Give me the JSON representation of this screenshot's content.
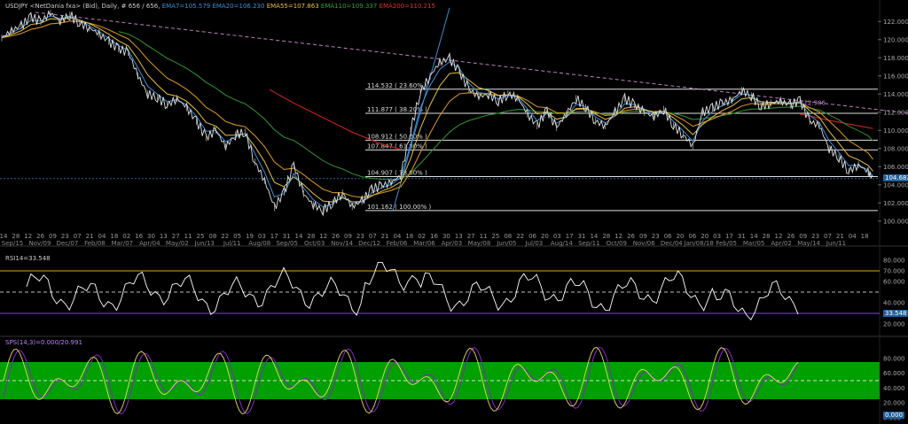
{
  "header": {
    "pair": "USDJPY",
    "source": "<NetDania fxa>",
    "feed": "(Bid), Daily",
    "bars": "# 656 / 656",
    "ema7": "EMA7=105.579",
    "ema20": "EMA20=106.230",
    "ema55": "EMA55=107.863",
    "ema110": "EMA110=109.337",
    "ema200": "EMA200=110.215"
  },
  "colors": {
    "background": "#000000",
    "price": "#e0e0e0",
    "ema7": "#3a8fd8",
    "ema20": "#e8c040",
    "ema55": "#d09020",
    "ema110": "#2e8a2e",
    "ema200": "#c02020",
    "rsi": "#ffffff",
    "rsi_low_line": "#8040ff",
    "rsi_high_line": "#e8a020",
    "stoch_k": "#e0e060",
    "stoch_d": "#9020d0",
    "stoch_band": "#00a000",
    "last_tag": "#2060a0",
    "trendline": "#c080c0"
  },
  "chart_data": [
    {
      "type": "line",
      "name": "price",
      "ylim": [
        99,
        123
      ],
      "y_ticks": [
        "122.000",
        "120.000",
        "118.000",
        "116.000",
        "114.000",
        "112.000",
        "110.000",
        "108.000",
        "106.000",
        "104.000",
        "102.000",
        "100.000"
      ],
      "x_tick_labels": [
        "14",
        "28",
        "12",
        "26",
        "09",
        "23",
        "07",
        "21",
        "04",
        "18",
        "02",
        "16",
        "30",
        "13",
        "27",
        "11",
        "25",
        "08",
        "22",
        "05",
        "19",
        "03",
        "17",
        "31",
        "14",
        "28",
        "12",
        "26",
        "09",
        "23",
        "07",
        "21",
        "04",
        "18",
        "02",
        "16",
        "30",
        "13",
        "27",
        "11",
        "25",
        "08",
        "22",
        "06",
        "20",
        "03",
        "17",
        "31",
        "14",
        "28",
        "12",
        "26",
        "09",
        "23",
        "06",
        "20",
        "06",
        "20",
        "03",
        "17",
        "31",
        "14",
        "28",
        "12",
        "26",
        "09",
        "23",
        "07",
        "21",
        "04",
        "18"
      ],
      "x_month_labels": [
        "Sep/15",
        "Nov/09",
        "Dec/07",
        "Feb/08",
        "Mar/07",
        "Apr/04",
        "May/02",
        "Jun/13",
        "Jul/11",
        "Aug/08",
        "Sep/05",
        "Oct/03",
        "Nov/14",
        "Dec/12",
        "Feb/06",
        "Mar/06",
        "Apr/03",
        "May/08",
        "Jun/05",
        "Jul/03",
        "Aug/14",
        "Sep/11",
        "Oct/09",
        "Nov/06",
        "Dec/04",
        "Jan/08/18",
        "Feb/05",
        "Mar/05",
        "Apr/02",
        "May/14",
        "Jun/11"
      ],
      "last_price": "104.682",
      "fib_levels": [
        {
          "label": "114.532 ( 23.60% )",
          "value": 114.532
        },
        {
          "label": "111.877 ( 38.20% )",
          "value": 111.877
        },
        {
          "label": "108.912 ( 50.00% )",
          "value": 108.912
        },
        {
          "label": "107.847 ( 61.80% )",
          "value": 107.847
        },
        {
          "label": "104.907 ( 78.60% )",
          "value": 104.907
        },
        {
          "label": "101.162 ( 100.00% )",
          "value": 101.162
        }
      ],
      "trendline_label": "112.986",
      "price_path": [
        [
          0,
          120.2
        ],
        [
          10,
          121.0
        ],
        [
          20,
          121.5
        ],
        [
          30,
          122.5
        ],
        [
          40,
          122.0
        ],
        [
          50,
          122.9
        ],
        [
          60,
          122.1
        ],
        [
          70,
          122.7
        ],
        [
          80,
          121.8
        ],
        [
          90,
          121.3
        ],
        [
          100,
          120.6
        ],
        [
          110,
          119.8
        ],
        [
          120,
          119.0
        ],
        [
          130,
          118.6
        ],
        [
          140,
          116.0
        ],
        [
          150,
          114.0
        ],
        [
          160,
          113.6
        ],
        [
          170,
          112.8
        ],
        [
          180,
          113.5
        ],
        [
          190,
          112.5
        ],
        [
          200,
          111.0
        ],
        [
          210,
          109.2
        ],
        [
          220,
          110.0
        ],
        [
          230,
          108.2
        ],
        [
          240,
          109.5
        ],
        [
          250,
          109.8
        ],
        [
          260,
          106.5
        ],
        [
          270,
          104.5
        ],
        [
          280,
          101.5
        ],
        [
          290,
          103.2
        ],
        [
          300,
          106.2
        ],
        [
          310,
          103.0
        ],
        [
          320,
          101.8
        ],
        [
          330,
          101.2
        ],
        [
          340,
          102.0
        ],
        [
          350,
          103.1
        ],
        [
          360,
          101.6
        ],
        [
          370,
          102.2
        ],
        [
          380,
          103.5
        ],
        [
          390,
          103.9
        ],
        [
          400,
          104.2
        ],
        [
          410,
          105.1
        ],
        [
          420,
          110.0
        ],
        [
          430,
          114.2
        ],
        [
          440,
          116.0
        ],
        [
          450,
          117.5
        ],
        [
          460,
          117.9
        ],
        [
          470,
          116.5
        ],
        [
          480,
          114.5
        ],
        [
          490,
          113.7
        ],
        [
          500,
          114.0
        ],
        [
          510,
          113.2
        ],
        [
          520,
          114.0
        ],
        [
          530,
          113.6
        ],
        [
          540,
          111.8
        ],
        [
          550,
          110.5
        ],
        [
          560,
          112.2
        ],
        [
          570,
          110.3
        ],
        [
          580,
          111.8
        ],
        [
          590,
          113.5
        ],
        [
          600,
          112.5
        ],
        [
          610,
          111.0
        ],
        [
          620,
          110.5
        ],
        [
          630,
          112.0
        ],
        [
          640,
          113.5
        ],
        [
          650,
          112.8
        ],
        [
          660,
          112.0
        ],
        [
          670,
          111.5
        ],
        [
          680,
          112.3
        ],
        [
          690,
          110.5
        ],
        [
          700,
          109.5
        ],
        [
          710,
          108.3
        ],
        [
          720,
          112.0
        ],
        [
          730,
          112.5
        ],
        [
          740,
          113.0
        ],
        [
          750,
          113.3
        ],
        [
          760,
          114.4
        ],
        [
          770,
          113.8
        ],
        [
          780,
          112.6
        ],
        [
          790,
          113.0
        ],
        [
          800,
          113.2
        ],
        [
          810,
          112.8
        ],
        [
          820,
          113.3
        ],
        [
          830,
          111.0
        ],
        [
          840,
          110.5
        ],
        [
          850,
          108.0
        ],
        [
          860,
          107.0
        ],
        [
          870,
          105.5
        ],
        [
          880,
          106.2
        ],
        [
          890,
          105.4
        ],
        [
          895,
          104.7
        ]
      ],
      "ema200_path": [
        [
          275,
          114.5
        ],
        [
          300,
          113.0
        ],
        [
          330,
          111.4
        ],
        [
          360,
          109.8
        ],
        [
          390,
          108.5
        ],
        [
          410,
          107.9
        ]
      ],
      "ema200_path2": [
        [
          820,
          111.8
        ],
        [
          850,
          111.1
        ],
        [
          875,
          110.6
        ],
        [
          895,
          110.2
        ]
      ]
    },
    {
      "type": "line",
      "name": "RSI",
      "label": "RSI14=33.548",
      "ylim": [
        15,
        80
      ],
      "y_ticks": [
        "80.000",
        "70.000",
        "60.000",
        "40.000",
        "30.000",
        "20.000"
      ],
      "last_value": "33.548",
      "levels": [
        30,
        50,
        70
      ]
    },
    {
      "type": "area",
      "name": "Stochastic",
      "label": "SPS(14,3)=0.000/20.991",
      "ylim": [
        0,
        100
      ],
      "y_ticks": [
        "80.000",
        "60.000",
        "40.000",
        "20.000",
        "0.000"
      ],
      "last_value": "0.000",
      "band": [
        25,
        75
      ]
    }
  ]
}
